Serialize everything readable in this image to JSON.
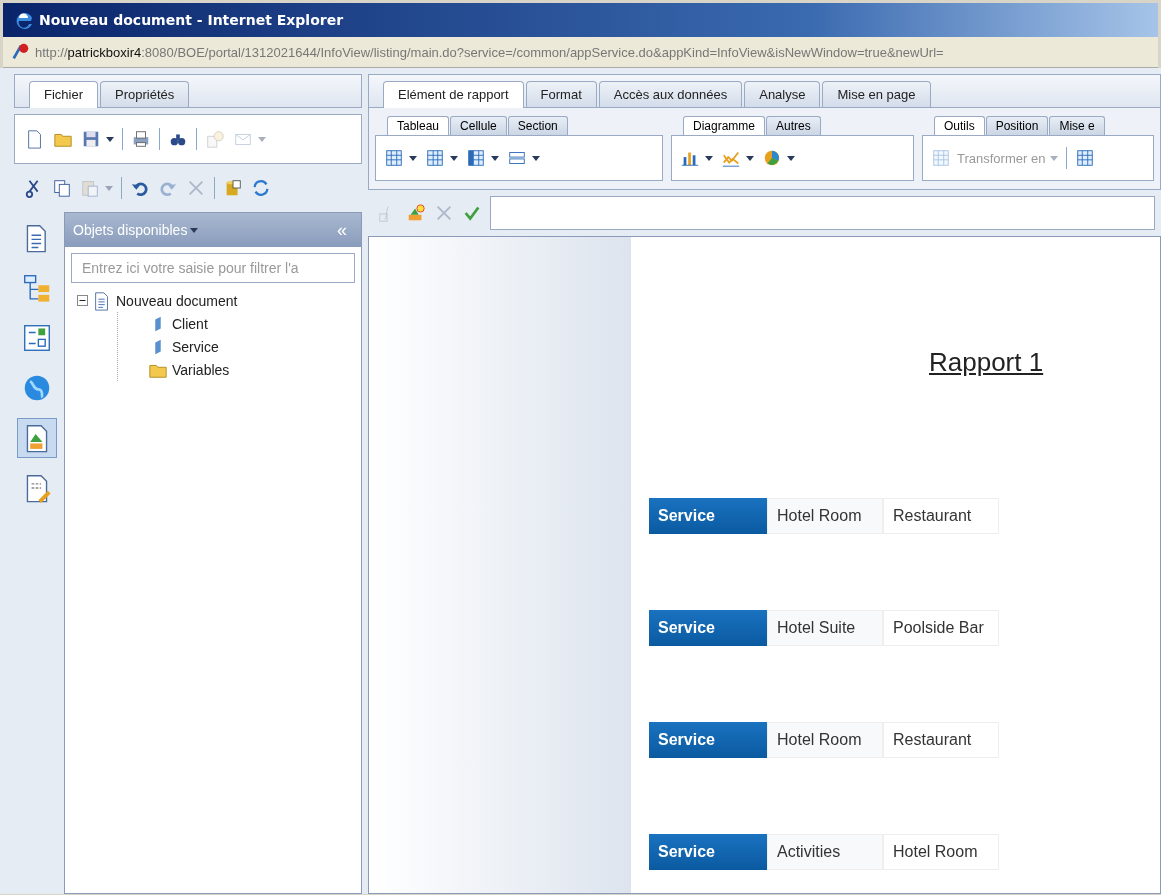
{
  "window": {
    "title": "Nouveau document - Internet Explorer"
  },
  "address": {
    "prefix": "http://",
    "host": "patrickboxir4",
    "rest": ":8080/BOE/portal/1312021644/InfoView/listing/main.do?service=/common/appService.do&appKind=InfoView&isNewWindow=true&newUrl="
  },
  "left_tabs": [
    {
      "label": "Fichier",
      "selected": true
    },
    {
      "label": "Propriétés",
      "selected": false
    }
  ],
  "file_toolbar": [
    {
      "kind": "new",
      "disabled": false
    },
    {
      "kind": "open",
      "disabled": false
    },
    {
      "kind": "save",
      "disabled": false
    },
    {
      "kind": "caret",
      "disabled": false
    },
    {
      "kind": "sep"
    },
    {
      "kind": "print",
      "disabled": false
    },
    {
      "kind": "sep"
    },
    {
      "kind": "find",
      "disabled": false
    },
    {
      "kind": "sep"
    },
    {
      "kind": "schedule",
      "disabled": true
    },
    {
      "kind": "mail",
      "disabled": true
    },
    {
      "kind": "caret",
      "disabled": true
    }
  ],
  "edit_toolbar": [
    {
      "kind": "cut",
      "disabled": false
    },
    {
      "kind": "copy",
      "disabled": false
    },
    {
      "kind": "paste",
      "disabled": true
    },
    {
      "kind": "caret",
      "disabled": true
    },
    {
      "kind": "sep"
    },
    {
      "kind": "undo",
      "disabled": false
    },
    {
      "kind": "redo",
      "disabled": true
    },
    {
      "kind": "delete",
      "disabled": true
    },
    {
      "kind": "sep"
    },
    {
      "kind": "database",
      "disabled": false
    },
    {
      "kind": "refresh",
      "disabled": false
    }
  ],
  "side_icons": [
    {
      "kind": "document",
      "selected": false
    },
    {
      "kind": "tree",
      "selected": false
    },
    {
      "kind": "checklist",
      "selected": false
    },
    {
      "kind": "globe",
      "selected": false
    },
    {
      "kind": "report",
      "selected": true
    },
    {
      "kind": "edit",
      "selected": false
    }
  ],
  "panel": {
    "title": "Objets disponibles",
    "collapse": "«",
    "filter_placeholder": "Entrez ici votre saisie pour filtrer l'a",
    "tree": [
      {
        "label": "Nouveau document",
        "kind": "document",
        "expanded": true,
        "children": [
          {
            "label": "Client",
            "kind": "dimension"
          },
          {
            "label": "Service",
            "kind": "dimension"
          },
          {
            "label": "Variables",
            "kind": "folder"
          }
        ]
      }
    ]
  },
  "ribbon_tabs": [
    {
      "label": "Elément de rapport",
      "selected": true
    },
    {
      "label": "Format",
      "selected": false
    },
    {
      "label": "Accès aux données",
      "selected": false
    },
    {
      "label": "Analyse",
      "selected": false
    },
    {
      "label": "Mise en page",
      "selected": false
    }
  ],
  "ribbon_groups": [
    {
      "tabs": [
        {
          "label": "Tableau",
          "selected": true
        },
        {
          "label": "Cellule",
          "selected": false
        },
        {
          "label": "Section",
          "selected": false
        }
      ],
      "tools": [
        {
          "kind": "table",
          "disabled": false
        },
        {
          "kind": "caret",
          "disabled": false
        },
        {
          "kind": "columns",
          "disabled": false
        },
        {
          "kind": "caret",
          "disabled": false
        },
        {
          "kind": "crosstab",
          "disabled": false
        },
        {
          "kind": "caret",
          "disabled": false
        },
        {
          "kind": "form",
          "disabled": false
        },
        {
          "kind": "caret",
          "disabled": false
        }
      ]
    },
    {
      "tabs": [
        {
          "label": "Diagramme",
          "selected": true
        },
        {
          "label": "Autres",
          "selected": false
        }
      ],
      "tools": [
        {
          "kind": "bars",
          "disabled": false
        },
        {
          "kind": "caret",
          "disabled": false
        },
        {
          "kind": "lines",
          "disabled": false
        },
        {
          "kind": "caret",
          "disabled": false
        },
        {
          "kind": "pie",
          "disabled": false
        },
        {
          "kind": "caret",
          "disabled": false
        }
      ]
    },
    {
      "tabs": [
        {
          "label": "Outils",
          "selected": true
        },
        {
          "label": "Position",
          "selected": false
        },
        {
          "label": "Mise e",
          "selected": false
        }
      ],
      "tools": [
        {
          "kind": "transform",
          "label": "Transformer en",
          "disabled": true
        },
        {
          "kind": "caret",
          "disabled": true
        },
        {
          "kind": "sep"
        },
        {
          "kind": "grid",
          "disabled": false
        }
      ]
    }
  ],
  "formula_bar": [
    {
      "kind": "formula",
      "disabled": true
    },
    {
      "kind": "variable",
      "disabled": false
    },
    {
      "kind": "cancel",
      "disabled": true
    },
    {
      "kind": "validate",
      "disabled": false
    }
  ],
  "report": {
    "title": "Rapport 1",
    "rows": [
      {
        "header": "Service",
        "values": [
          "Hotel Room",
          "Restaurant"
        ]
      },
      {
        "header": "Service",
        "values": [
          "Hotel Suite",
          "Poolside Bar"
        ]
      },
      {
        "header": "Service",
        "values": [
          "Hotel Room",
          "Restaurant"
        ]
      },
      {
        "header": "Service",
        "values": [
          "Activities",
          "Hotel Room"
        ]
      }
    ]
  }
}
